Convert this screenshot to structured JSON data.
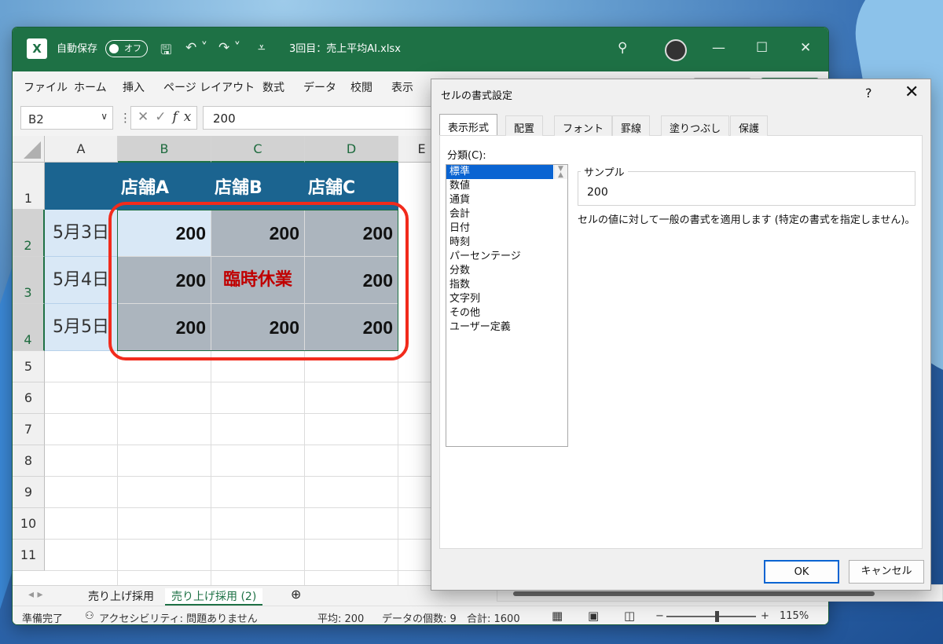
{
  "window": {
    "autosave_label": "自動保存",
    "autosave_state": "オフ",
    "filename": "3回目：売上平均AI.xlsx",
    "icons": [
      "excel-icon",
      "save-icon",
      "undo-icon",
      "redo-icon",
      "customize-icon",
      "search-icon",
      "minimize-icon",
      "maximize-icon",
      "close-icon"
    ]
  },
  "menu": [
    "ファイル",
    "ホーム",
    "挿入",
    "ページ レイアウト",
    "数式",
    "データ",
    "校閲",
    "表示"
  ],
  "formula_bar": {
    "cell_ref": "B2",
    "value": "200",
    "fx": "fx"
  },
  "columns": [
    "A",
    "B",
    "C",
    "D",
    "E"
  ],
  "rows": [
    "1",
    "2",
    "3",
    "4",
    "5",
    "6",
    "7",
    "8",
    "9",
    "10",
    "11"
  ],
  "table": {
    "headers": [
      "店舗A",
      "店舗B",
      "店舗C"
    ],
    "dates": [
      "5月3日",
      "5月4日",
      "5月5日"
    ],
    "values": [
      [
        "200",
        "200",
        "200"
      ],
      [
        "200",
        "臨時休業",
        "200"
      ],
      [
        "200",
        "200",
        "200"
      ]
    ]
  },
  "sheet_tabs": {
    "tab1": "売り上げ採用",
    "tab2": "売り上げ採用 (2)",
    "add": "⊕"
  },
  "status": {
    "ready": "準備完了",
    "accessibility": "アクセシビリティ: 問題ありません",
    "average": "平均: 200",
    "count": "データの個数: 9",
    "sum": "合計: 1600",
    "zoom": "115%",
    "zoom_level_pct": 115
  },
  "dialog": {
    "title": "セルの書式設定",
    "help": "?",
    "tabs": [
      "表示形式",
      "配置",
      "フォント",
      "罫線",
      "塗りつぶし",
      "保護"
    ],
    "category_label": "分類(C):",
    "categories": [
      "標準",
      "数値",
      "通貨",
      "会計",
      "日付",
      "時刻",
      "パーセンテージ",
      "分数",
      "指数",
      "文字列",
      "その他",
      "ユーザー定義"
    ],
    "selected_category": "標準",
    "sample_label": "サンプル",
    "sample_value": "200",
    "description": "セルの値に対して一般の書式を適用します (特定の書式を指定しません)。",
    "ok": "OK",
    "cancel": "キャンセル"
  },
  "colors": {
    "excel_green": "#1e7145",
    "header_blue": "#1b6490",
    "highlight_red": "#f22b1c",
    "closed_red": "#c00000",
    "dialog_select": "#0a64d2"
  }
}
